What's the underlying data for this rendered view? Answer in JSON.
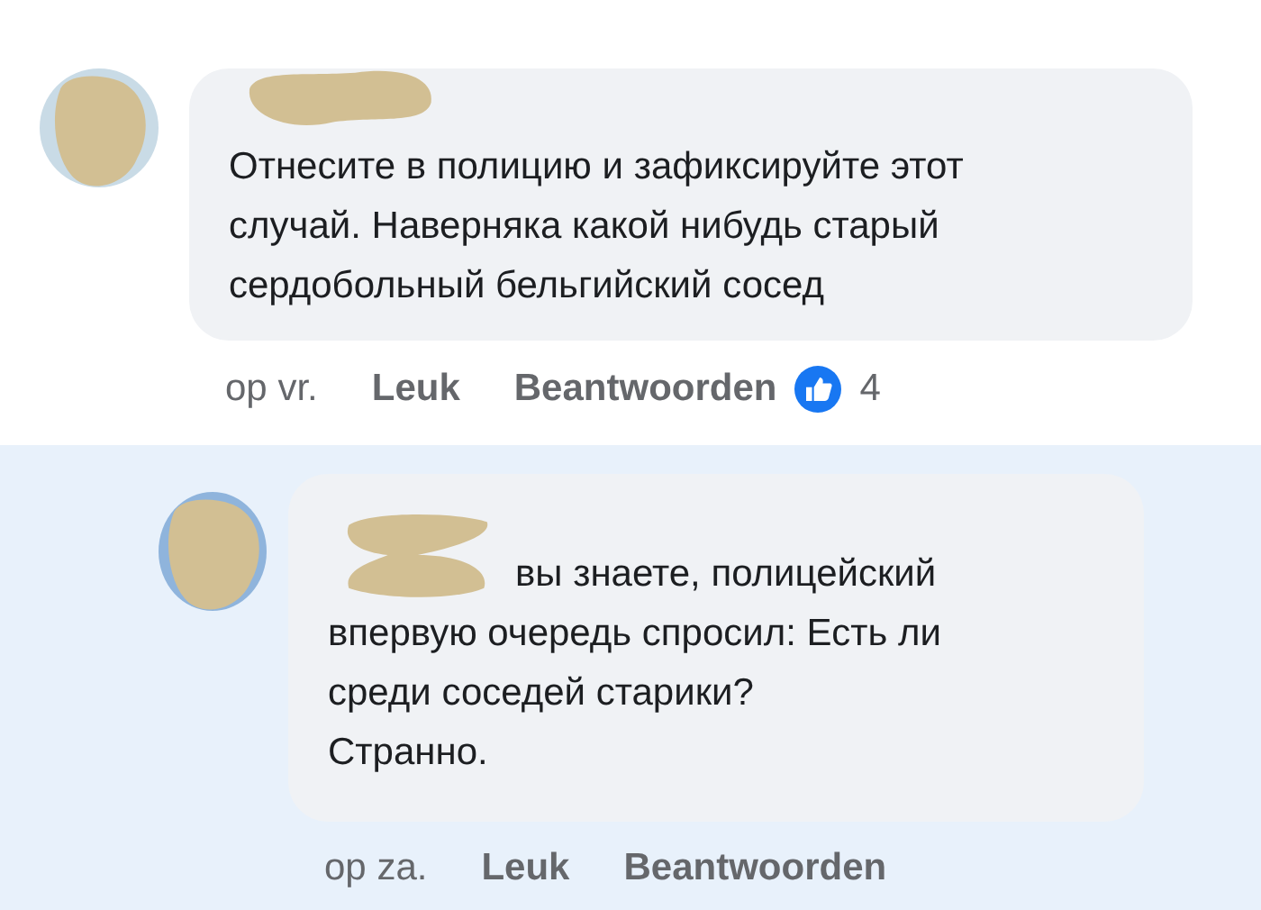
{
  "comments": [
    {
      "reply": false,
      "highlighted": false,
      "text": "Отнесите в полицию и зафиксируйте этот случай. Наверняка какой нибудь старый сердобольный бельгийский сосед",
      "time": "op vr.",
      "like": "Leuk",
      "answer": "Beantwoorden",
      "reactions": "4"
    },
    {
      "reply": true,
      "highlighted": true,
      "text": "вы знаете, полицейский впервую очередь спросил: Есть ли среди соседей старики?\nСтранно.",
      "time": "op za.",
      "like": "Leuk",
      "answer": "Beantwoorden"
    }
  ]
}
